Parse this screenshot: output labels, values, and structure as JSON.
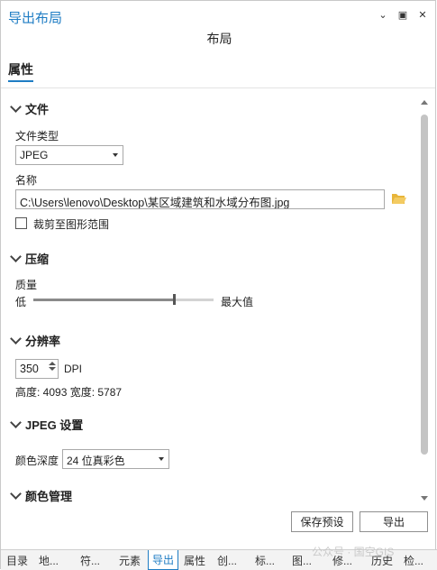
{
  "window": {
    "title": "导出布局",
    "menu_icon": "chevron-down-icon",
    "maximize_icon": "maximize-icon",
    "close_icon": "close-icon"
  },
  "subtitle": "布局",
  "tab": "属性",
  "sections": {
    "file": {
      "header": "文件",
      "type_label": "文件类型",
      "type_value": "JPEG",
      "name_label": "名称",
      "name_value": "C:\\Users\\lenovo\\Desktop\\某区域建筑和水域分布图.jpg",
      "clip_label": "裁剪至图形范围"
    },
    "compress": {
      "header": "压缩",
      "quality_label": "质量",
      "low_label": "低",
      "high_label": "最大值",
      "quality_level_percent": 78
    },
    "resolution": {
      "header": "分辨率",
      "dpi_value": "350",
      "dpi_unit": "DPI",
      "size_text": "高度: 4093 宽度: 5787"
    },
    "jpeg": {
      "header": "JPEG 设置",
      "color_depth_label": "颜色深度",
      "color_depth_value": "24 位真彩色"
    },
    "color": {
      "header": "颜色管理"
    }
  },
  "buttons": {
    "save_preset": "保存预设",
    "export": "导出"
  },
  "bottom_tabs": [
    "目录",
    "地...",
    "符...",
    "元素",
    "导出",
    "属性",
    "创...",
    "标...",
    "图...",
    "修...",
    "历史",
    "检..."
  ],
  "watermark": "公众号 · 国空GIS",
  "colors": {
    "accent": "#1f7dc4",
    "folder": "#e8b53a"
  }
}
